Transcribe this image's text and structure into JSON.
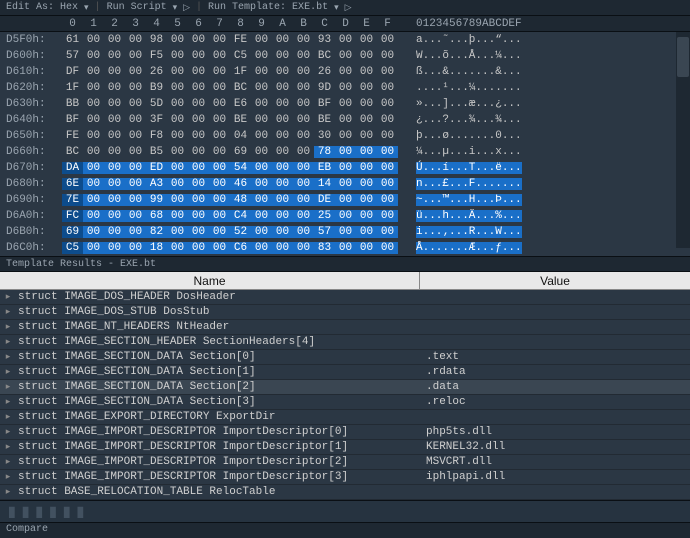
{
  "toolbar": {
    "edit_as": "Edit As: Hex",
    "run_script": "Run Script",
    "run_template": "Run Template: EXE.bt"
  },
  "hex_header": {
    "cols": [
      "0",
      "1",
      "2",
      "3",
      "4",
      "5",
      "6",
      "7",
      "8",
      "9",
      "A",
      "B",
      "C",
      "D",
      "E",
      "F"
    ],
    "ascii": "0123456789ABCDEF"
  },
  "hex_rows": [
    {
      "off": "D5F0h:",
      "bytes": [
        "61",
        "00",
        "00",
        "00",
        "98",
        "00",
        "00",
        "00",
        "FE",
        "00",
        "00",
        "00",
        "93",
        "00",
        "00",
        "00"
      ],
      "ascii": "a...˜...þ...“...",
      "sel": false
    },
    {
      "off": "D600h:",
      "bytes": [
        "57",
        "00",
        "00",
        "00",
        "F5",
        "00",
        "00",
        "00",
        "C5",
        "00",
        "00",
        "00",
        "BC",
        "00",
        "00",
        "00"
      ],
      "ascii": "W...õ...Å...¼...",
      "sel": false
    },
    {
      "off": "D610h:",
      "bytes": [
        "DF",
        "00",
        "00",
        "00",
        "26",
        "00",
        "00",
        "00",
        "1F",
        "00",
        "00",
        "00",
        "26",
        "00",
        "00",
        "00"
      ],
      "ascii": "ß...&.......&...",
      "sel": false
    },
    {
      "off": "D620h:",
      "bytes": [
        "1F",
        "00",
        "00",
        "00",
        "B9",
        "00",
        "00",
        "00",
        "BC",
        "00",
        "00",
        "00",
        "9D",
        "00",
        "00",
        "00"
      ],
      "ascii": "....¹...¼.......",
      "sel": false
    },
    {
      "off": "D630h:",
      "bytes": [
        "BB",
        "00",
        "00",
        "00",
        "5D",
        "00",
        "00",
        "00",
        "E6",
        "00",
        "00",
        "00",
        "BF",
        "00",
        "00",
        "00"
      ],
      "ascii": "»...]...æ...¿...",
      "sel": false
    },
    {
      "off": "D640h:",
      "bytes": [
        "BF",
        "00",
        "00",
        "00",
        "3F",
        "00",
        "00",
        "00",
        "BE",
        "00",
        "00",
        "00",
        "BE",
        "00",
        "00",
        "00"
      ],
      "ascii": "¿...?...¾...¾...",
      "sel": false
    },
    {
      "off": "D650h:",
      "bytes": [
        "FE",
        "00",
        "00",
        "00",
        "F8",
        "00",
        "00",
        "00",
        "04",
        "00",
        "00",
        "00",
        "30",
        "00",
        "00",
        "00"
      ],
      "ascii": "þ...ø.......0...",
      "sel": false
    },
    {
      "off": "D660h:",
      "bytes": [
        "BC",
        "00",
        "00",
        "00",
        "B5",
        "00",
        "00",
        "00",
        "69",
        "00",
        "00",
        "00",
        "78",
        "00",
        "00",
        "00"
      ],
      "ascii": "¼...µ...i...x...",
      "sel": false,
      "partstart": 12
    },
    {
      "off": "D670h:",
      "bytes": [
        "DA",
        "00",
        "00",
        "00",
        "ED",
        "00",
        "00",
        "00",
        "54",
        "00",
        "00",
        "00",
        "EB",
        "00",
        "00",
        "00"
      ],
      "ascii": "Ú...í...T...ë...",
      "sel": true
    },
    {
      "off": "D680h:",
      "bytes": [
        "6E",
        "00",
        "00",
        "00",
        "A3",
        "00",
        "00",
        "00",
        "46",
        "00",
        "00",
        "00",
        "14",
        "00",
        "00",
        "00"
      ],
      "ascii": "n...£...F.......",
      "sel": true
    },
    {
      "off": "D690h:",
      "bytes": [
        "7E",
        "00",
        "00",
        "00",
        "99",
        "00",
        "00",
        "00",
        "48",
        "00",
        "00",
        "00",
        "DE",
        "00",
        "00",
        "00"
      ],
      "ascii": "~...™...H...Þ...",
      "sel": true
    },
    {
      "off": "D6A0h:",
      "bytes": [
        "FC",
        "00",
        "00",
        "00",
        "68",
        "00",
        "00",
        "00",
        "C4",
        "00",
        "00",
        "00",
        "25",
        "00",
        "00",
        "00"
      ],
      "ascii": "ü...h...Ä...%...",
      "sel": true
    },
    {
      "off": "D6B0h:",
      "bytes": [
        "69",
        "00",
        "00",
        "00",
        "82",
        "00",
        "00",
        "00",
        "52",
        "00",
        "00",
        "00",
        "57",
        "00",
        "00",
        "00"
      ],
      "ascii": "i...‚...R...W...",
      "sel": true
    },
    {
      "off": "D6C0h:",
      "bytes": [
        "C5",
        "00",
        "00",
        "00",
        "18",
        "00",
        "00",
        "00",
        "C6",
        "00",
        "00",
        "00",
        "83",
        "00",
        "00",
        "00"
      ],
      "ascii": "Å.......Æ...ƒ...",
      "sel": true
    }
  ],
  "template_header": "Template Results - EXE.bt",
  "template_cols": {
    "name": "Name",
    "value": "Value"
  },
  "template_rows": [
    {
      "name": "struct IMAGE_DOS_HEADER DosHeader",
      "value": ""
    },
    {
      "name": "struct IMAGE_DOS_STUB DosStub",
      "value": ""
    },
    {
      "name": "struct IMAGE_NT_HEADERS NtHeader",
      "value": ""
    },
    {
      "name": "struct IMAGE_SECTION_HEADER SectionHeaders[4]",
      "value": ""
    },
    {
      "name": "struct IMAGE_SECTION_DATA Section[0]",
      "value": ".text"
    },
    {
      "name": "struct IMAGE_SECTION_DATA Section[1]",
      "value": ".rdata"
    },
    {
      "name": "struct IMAGE_SECTION_DATA Section[2]",
      "value": ".data",
      "hi": true
    },
    {
      "name": "struct IMAGE_SECTION_DATA Section[3]",
      "value": ".reloc"
    },
    {
      "name": "struct IMAGE_EXPORT_DIRECTORY ExportDir",
      "value": ""
    },
    {
      "name": "struct IMAGE_IMPORT_DESCRIPTOR ImportDescriptor[0]",
      "value": "php5ts.dll"
    },
    {
      "name": "struct IMAGE_IMPORT_DESCRIPTOR ImportDescriptor[1]",
      "value": "KERNEL32.dll"
    },
    {
      "name": "struct IMAGE_IMPORT_DESCRIPTOR ImportDescriptor[2]",
      "value": "MSVCRT.dll"
    },
    {
      "name": "struct IMAGE_IMPORT_DESCRIPTOR ImportDescriptor[3]",
      "value": "iphlpapi.dll"
    },
    {
      "name": "struct BASE_RELOCATION_TABLE RelocTable",
      "value": ""
    }
  ],
  "compare_label": "Compare"
}
